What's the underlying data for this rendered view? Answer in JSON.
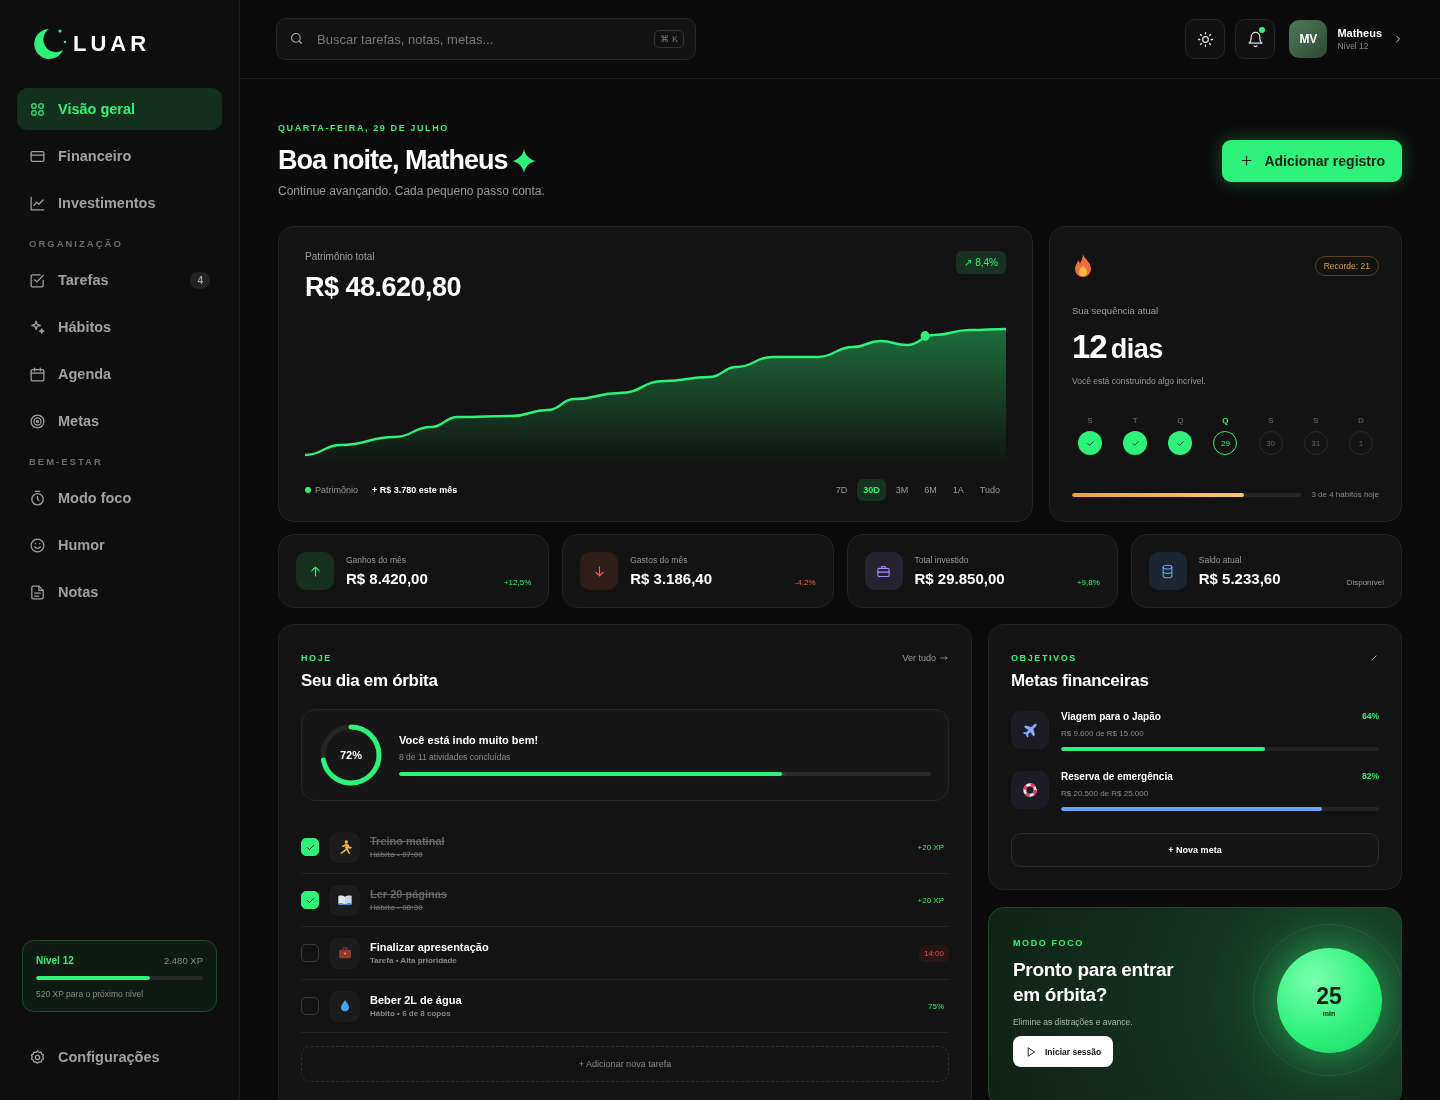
{
  "brand": {
    "name": "LUAR"
  },
  "sidebar": {
    "groups": [
      {
        "items": [
          {
            "label": "Visão geral",
            "selected": true
          },
          {
            "label": "Financeiro",
            "selected": false
          },
          {
            "label": "Investimentos",
            "selected": false
          }
        ]
      },
      {
        "heading": "ORGANIZAÇÃO",
        "items": [
          {
            "label": "Tarefas",
            "selected": false,
            "badge": "4"
          },
          {
            "label": "Hábitos",
            "selected": false
          },
          {
            "label": "Agenda",
            "selected": false
          },
          {
            "label": "Metas",
            "selected": false
          }
        ]
      },
      {
        "heading": "BEM-ESTAR",
        "items": [
          {
            "label": "Modo foco",
            "selected": false
          },
          {
            "label": "Humor",
            "selected": false
          },
          {
            "label": "Notas",
            "selected": false
          }
        ]
      }
    ],
    "level_card": {
      "title": "Nível 12",
      "xp": "2.480 XP",
      "level": 0.68,
      "note": "520 XP para o próximo nível"
    },
    "settings": "Configurações"
  },
  "header": {
    "search": {
      "placeholder": "Buscar tarefas, notas, metas...",
      "shortcut": "⌘ K"
    },
    "notification": true,
    "user": {
      "initials": "MV",
      "name": "Matheus",
      "subtitle": "Nível 12"
    }
  },
  "greeting": {
    "date": "QUARTA-FEIRA, 29 DE JULHO",
    "title": "Boa noite, Matheus",
    "subtitle": "Continue avançando. Cada pequeno passo conta.",
    "button": "Adicionar registro"
  },
  "net_worth": {
    "label": "Patrimônio total",
    "value": "R$ 48.620,80",
    "change": "↗ 8,4%",
    "legend": "Patrimônio",
    "delta": "+ R$ 3.780 este mês",
    "ranges": [
      {
        "label": "7D",
        "selected": false
      },
      {
        "label": "30D",
        "selected": true
      },
      {
        "label": "3M",
        "selected": false
      },
      {
        "label": "6M",
        "selected": false
      },
      {
        "label": "1A",
        "selected": false
      },
      {
        "label": "Tudo",
        "selected": false
      }
    ]
  },
  "streak": {
    "record": "Recorde: 21",
    "label": "Sua sequência atual",
    "value": "12",
    "unit": "dias",
    "note": "Você está construindo algo incrível.",
    "days": [
      {
        "letter": "S",
        "done": true,
        "selected": false
      },
      {
        "letter": "T",
        "done": true,
        "selected": false
      },
      {
        "letter": "Q",
        "done": true,
        "selected": false
      },
      {
        "letter": "Q",
        "date": "29",
        "done": false,
        "selected": true
      },
      {
        "letter": "S",
        "date": "30",
        "done": false,
        "selected": false
      },
      {
        "letter": "S",
        "date": "31",
        "done": false,
        "selected": false
      },
      {
        "letter": "D",
        "date": "1",
        "done": false,
        "selected": false
      }
    ],
    "level": 0.75,
    "caption": "3 de 4 hábitos hoje"
  },
  "stats": [
    {
      "label": "Ganhos do mês",
      "value": "R$ 8.420,00",
      "change": "+12,5%",
      "kind": "up",
      "color": "#2ef27a"
    },
    {
      "label": "Gastos do mês",
      "value": "R$ 3.186,40",
      "change": "-4,2%",
      "kind": "down",
      "color": "#f0604a"
    },
    {
      "label": "Total investido",
      "value": "R$ 29.850,00",
      "change": "+9,8%",
      "kind": "up",
      "color": "#a78bfa"
    },
    {
      "label": "Saldo atual",
      "value": "R$ 5.233,60",
      "change": "Disponível",
      "kind": "neutral",
      "color": "#60a5fa"
    }
  ],
  "today": {
    "eyebrow": "HOJE",
    "title": "Seu dia em órbita",
    "link": "Ver tudo",
    "summary": {
      "percent": "72%",
      "level": 0.72,
      "title": "Você está indo muito bem!",
      "subtitle": "8 de 11 atividades concluídas"
    },
    "tasks": [
      {
        "title": "Treino matinal",
        "meta": "Hábito • 07:00",
        "checked": true,
        "trailing": "+20 XP",
        "kind": "xp"
      },
      {
        "title": "Ler 20 páginas",
        "meta": "Hábito • 08:30",
        "checked": true,
        "trailing": "+20 XP",
        "kind": "xp"
      },
      {
        "title": "Finalizar apresentação",
        "meta": "Tarefa • Alta prioridade",
        "checked": false,
        "trailing": "14:00",
        "kind": "time"
      },
      {
        "title": "Beber 2L de água",
        "meta": "Hábito • 6 de 8 copos",
        "checked": false,
        "trailing": "75%",
        "kind": "percent"
      }
    ],
    "add": "+ Adicionar nova tarefa"
  },
  "goals": {
    "eyebrow": "OBJETIVOS",
    "title": "Metas financeiras",
    "items": [
      {
        "name": "Viagem para o Japão",
        "amount": "R$ 9.600 de R$ 15.000",
        "percent": "64%",
        "level": 0.64,
        "color": "#2ef27a"
      },
      {
        "name": "Reserva de emergência",
        "amount": "R$ 20.500 de R$ 25.000",
        "percent": "82%",
        "level": 0.82,
        "color": "#60a5fa"
      }
    ],
    "button": "+ Nova meta"
  },
  "focus": {
    "eyebrow": "MODO FOCO",
    "title": "Pronto para entrar em órbita?",
    "subtitle": "Elimine as distrações e avance.",
    "button": "Iniciar sessão",
    "timer": "25",
    "unit": "min"
  }
}
